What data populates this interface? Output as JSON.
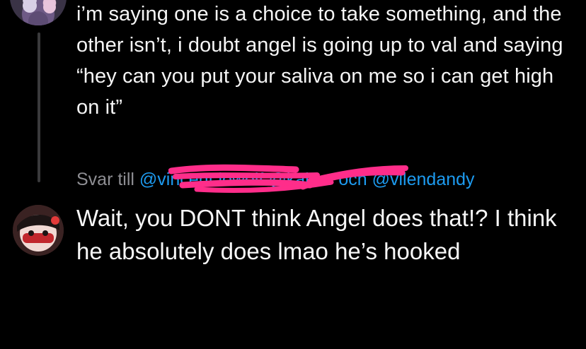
{
  "colors": {
    "background": "#000000",
    "text_primary": "#f5f5f5",
    "text_secondary": "#8e8e93",
    "mention": "#1d9bf0",
    "scribble": "#ff2d8a",
    "thread_line": "#3a3a3c"
  },
  "parent_post": {
    "text": "i’m saying one is a choice to take something, and the other isn’t, i doubt angel is going up to val and saying “hey can you put your saliva on me so i can get high on it”"
  },
  "reply_context": {
    "prefix": "Svar till",
    "mention_1": "@vincent lowolf",
    "mention_2": "@kaiser",
    "conjunction": "och",
    "mention_3": "@vilendandy"
  },
  "reply_post": {
    "text": "Wait, you DONT think Angel does that!? I think he absolutely does lmao he’s hooked"
  }
}
